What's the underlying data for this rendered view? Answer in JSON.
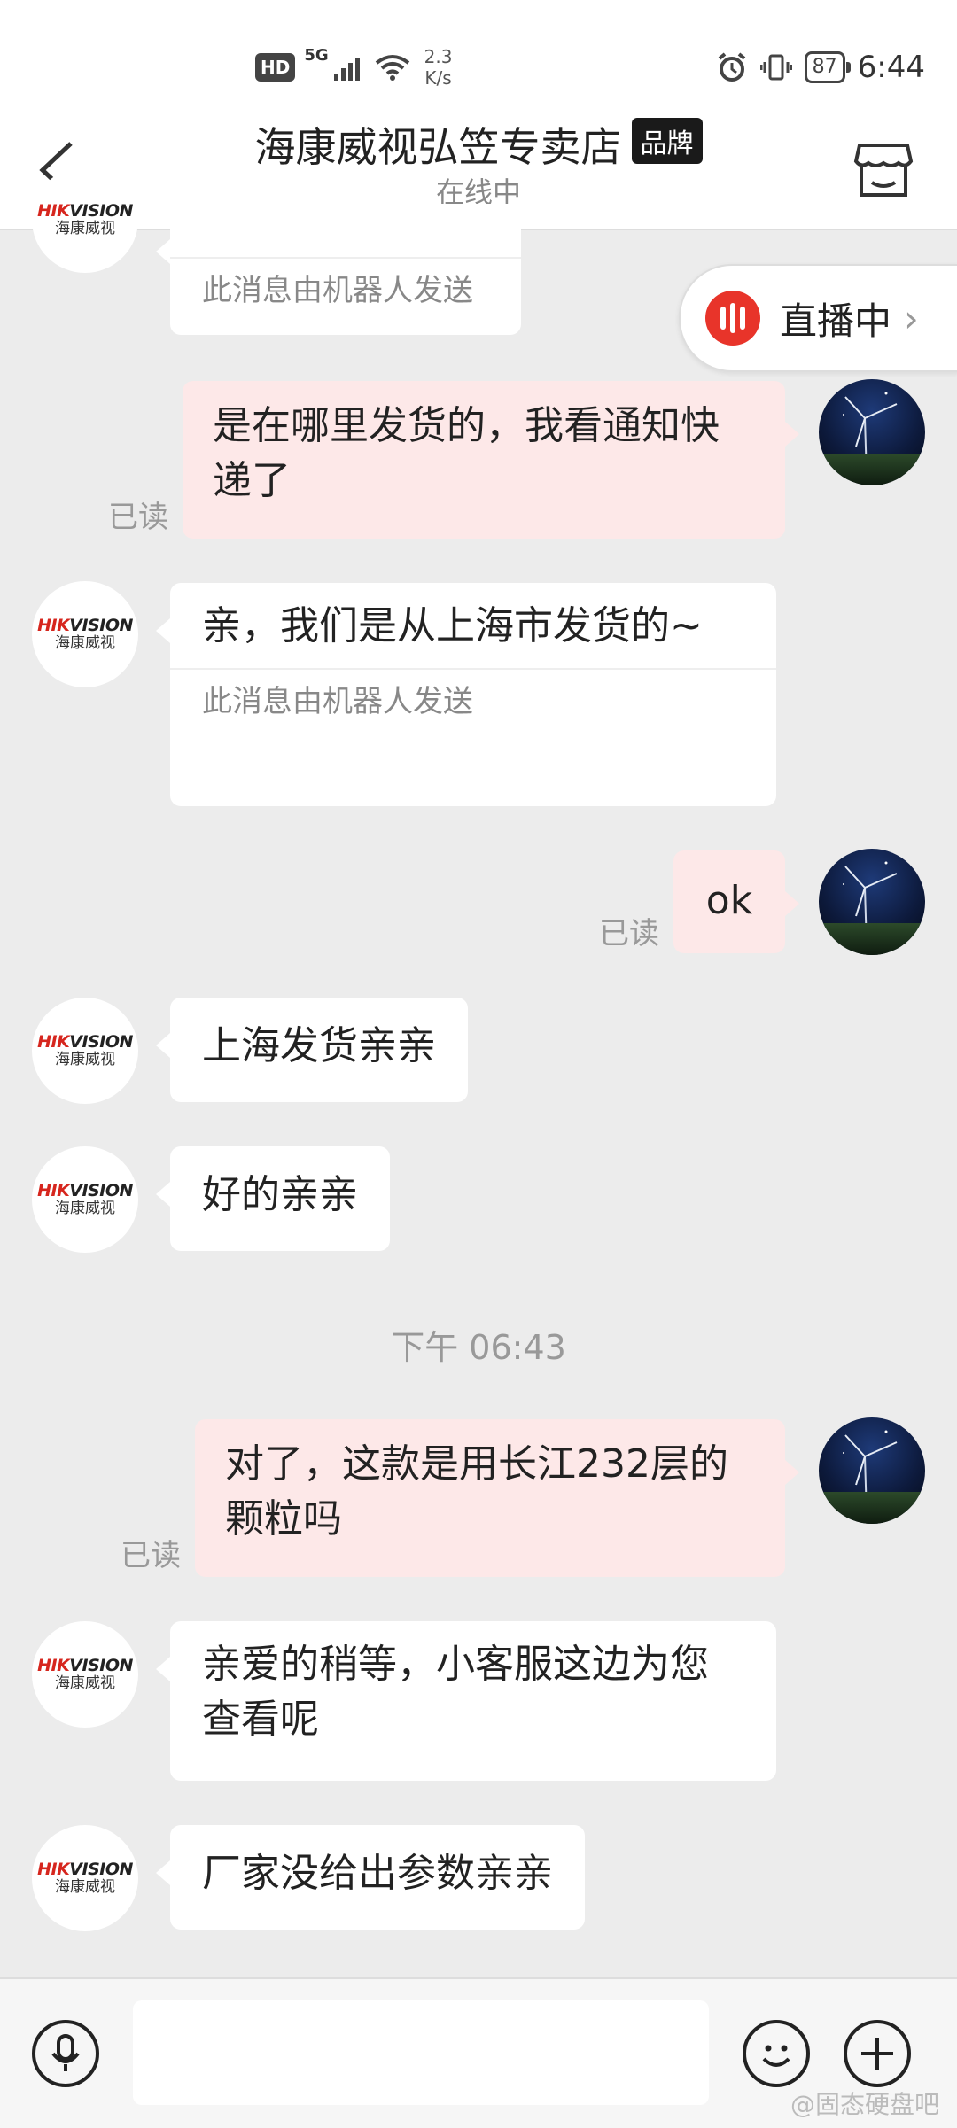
{
  "status_bar": {
    "hd": "HD",
    "signal_type": "5G",
    "net_speed_value": "2.3",
    "net_speed_unit": "K/s",
    "battery": "87",
    "time": "6:44"
  },
  "header": {
    "shop_name": "海康威视弘笠专卖店",
    "brand_badge": "品牌",
    "status": "在线中"
  },
  "live_badge": {
    "label": "直播中"
  },
  "messages": [
    {
      "robot_note": "此消息由机器人发送"
    },
    {
      "text": "是在哪里发货的，我看通知快递了",
      "read": "已读"
    },
    {
      "text": "亲，我们是从上海市发货的~",
      "robot_note": "此消息由机器人发送"
    },
    {
      "text": "ok",
      "read": "已读"
    },
    {
      "text": "上海发货亲亲"
    },
    {
      "text": "好的亲亲"
    },
    {
      "text": "对了，这款是用长江232层的颗粒吗",
      "read": "已读"
    },
    {
      "text": "亲爱的稍等，小客服这边为您查看呢"
    },
    {
      "text": "厂家没给出参数亲亲"
    }
  ],
  "time_separator": "下午 06:43",
  "shop_avatar": {
    "logo": "HIKVISION",
    "cn": "海康威视"
  },
  "input": {
    "value": ""
  },
  "watermark": "@固态硬盘吧",
  "colors": {
    "live_red": "#e8342a",
    "outgoing_bubble": "#fde8e8",
    "hik_red": "#d6261e"
  }
}
